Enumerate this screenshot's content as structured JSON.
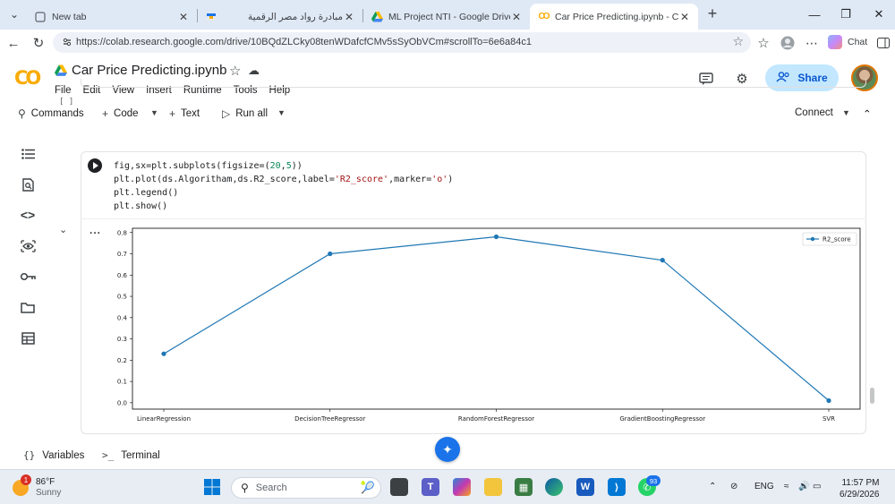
{
  "browser": {
    "tabs": [
      {
        "title": "New tab",
        "favicon": "page-icon",
        "active": false
      },
      {
        "title": "مبادرة رواد مصر الرقمية",
        "favicon": "flag-icon",
        "active": false
      },
      {
        "title": "ML Project NTI - Google Drive",
        "favicon": "drive-icon",
        "active": false
      },
      {
        "title": "Car Price Predicting.ipynb - Colab",
        "favicon": "colab-icon",
        "active": true
      }
    ],
    "url": "https://colab.research.google.com/drive/10BQdZLCky08tenWDafcfCMv5sSyObVCm#scrollTo=6e6a84c1",
    "chat_label": "Chat"
  },
  "colab": {
    "title": "Car Price Predicting.ipynb",
    "menu": [
      "File",
      "Edit",
      "View",
      "Insert",
      "Runtime",
      "Tools",
      "Help"
    ],
    "share_label": "Share",
    "toolbar": {
      "commands": "Commands",
      "code": "Code",
      "text": "Text",
      "run_all": "Run all",
      "connect": "Connect"
    },
    "cell": {
      "exec_count": "[ ]",
      "code_lines": [
        "fig,sx=plt.subplots(figsize=(20,5))",
        "plt.plot(ds.Algoritham,ds.R2_score,label='R2_score',marker='o')",
        "plt.legend()",
        "plt.show()"
      ],
      "output_menu": "..."
    },
    "bottom": {
      "variables": "Variables",
      "terminal": "Terminal"
    }
  },
  "chart_data": {
    "type": "line",
    "categories": [
      "LinearRegression",
      "DecisionTreeRegressor",
      "RandomForestRegressor",
      "GradientBoostingRegressor",
      "SVR"
    ],
    "series": [
      {
        "name": "R2_score",
        "values": [
          0.23,
          0.7,
          0.78,
          0.67,
          0.01
        ],
        "color": "#1f77b4",
        "marker": "o"
      }
    ],
    "yticks": [
      "0.0",
      "0.1",
      "0.2",
      "0.3",
      "0.4",
      "0.5",
      "0.6",
      "0.7",
      "0.8"
    ],
    "ylim": [
      -0.03,
      0.82
    ],
    "legend_position": "top-right",
    "grid": false
  },
  "taskbar": {
    "weather_temp": "86°F",
    "weather_desc": "Sunny",
    "weather_badge": "1",
    "search_placeholder": "Search",
    "language": "ENG",
    "time": "11:57 PM",
    "date": "6/29/2026",
    "whatsapp_badge": "93"
  }
}
